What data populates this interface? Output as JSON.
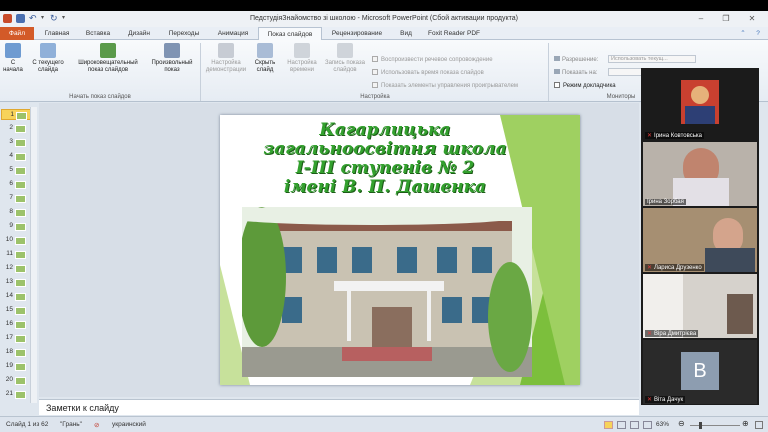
{
  "window": {
    "title": "ПедстудіяЗнайомство зі школою - Microsoft PowerPoint (Сбой активации продукта)"
  },
  "tabs": [
    {
      "label": "Файл"
    },
    {
      "label": "Главная"
    },
    {
      "label": "Вставка"
    },
    {
      "label": "Дизайн"
    },
    {
      "label": "Переходы"
    },
    {
      "label": "Анимация"
    },
    {
      "label": "Показ слайдов"
    },
    {
      "label": "Рецензирование"
    },
    {
      "label": "Вид"
    },
    {
      "label": "Foxit Reader PDF"
    }
  ],
  "ribbon": {
    "start_group": {
      "label": "Начать показ слайдов",
      "from_start": "С начала",
      "from_current": "С текущего слайда",
      "broadcast": "Широковещательный показ слайдов",
      "custom": "Произвольный показ"
    },
    "setup_group": {
      "label": "Настройка",
      "setup_show": "Настройка демонстрации",
      "hide_slide": "Скрыть слайд",
      "rehearse": "Настройка времени",
      "record": "Запись показа слайдов",
      "chk_narration": "Воспроизвести речевое сопровождение",
      "chk_timings": "Использовать время показа слайдов",
      "chk_controls": "Показать элементы управления проигрывателем"
    },
    "monitors_group": {
      "label": "Мониторы",
      "resolution_label": "Разрешение:",
      "resolution_value": "Использовать текущ...",
      "show_on_label": "Показать на:",
      "presenter_view": "Режим докладчика"
    }
  },
  "thumbnails": [
    "1",
    "2",
    "3",
    "4",
    "5",
    "6",
    "7",
    "8",
    "9",
    "10",
    "11",
    "12",
    "13",
    "14",
    "15",
    "16",
    "17",
    "18",
    "19",
    "20",
    "21"
  ],
  "slide": {
    "title_lines": [
      "Кагарлицька",
      "загальноосвітня школа",
      "І-ІІІ ступенів № 2",
      "імені В. П. Дашенка"
    ]
  },
  "notes": {
    "placeholder": "Заметки к слайду"
  },
  "status": {
    "slide_info": "Слайд 1 из 62",
    "theme": "\"Грань\"",
    "language": "украинский",
    "zoom": "63%"
  },
  "zoom_panel": {
    "participants": [
      {
        "name": "Ірина Ковтовська"
      },
      {
        "name": "Ірина Зорбая"
      },
      {
        "name": "Лариса Друзенко"
      },
      {
        "name": "Віра Дмитрієва"
      },
      {
        "name": "Віта Дачук",
        "initial": "В"
      }
    ]
  },
  "colors": {
    "file_tab": "#d35a28",
    "slide_title": "#33a12e",
    "selected_thumb": "#f7d35a"
  }
}
